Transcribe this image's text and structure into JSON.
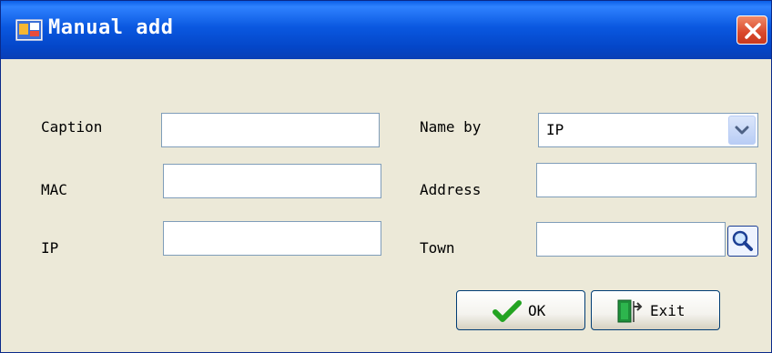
{
  "window": {
    "title": "Manual add"
  },
  "form": {
    "caption_label": "Caption",
    "mac_label": "MAC",
    "ip_label": "IP",
    "name_by_label": "Name by",
    "name_by_value": "IP",
    "address_label": "Address",
    "town_label": "Town",
    "caption_value": "",
    "mac_value": "",
    "ip_value": "",
    "address_value": "",
    "town_value": ""
  },
  "buttons": {
    "ok_label": "OK",
    "exit_label": "Exit"
  },
  "icons": {
    "app": "app-icon",
    "close": "close-icon",
    "dropdown": "chevron-down-icon",
    "search": "magnifier-icon",
    "ok": "checkmark-icon",
    "exit": "door-exit-icon"
  },
  "colors": {
    "titlebar": "#0a58e0",
    "close": "#d9482c",
    "dialog_bg": "#ece9d8",
    "field_border": "#7f9db9"
  }
}
